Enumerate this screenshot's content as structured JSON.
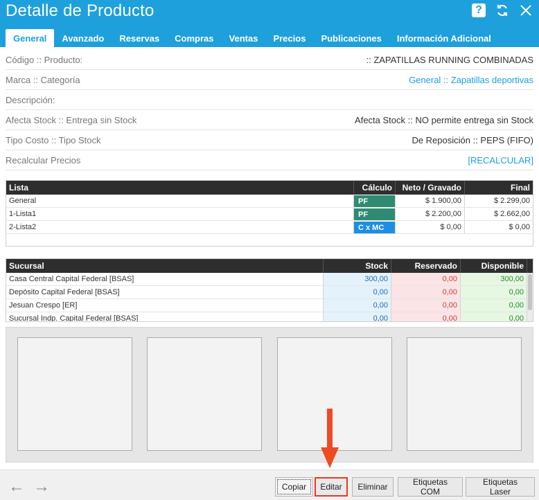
{
  "window": {
    "title": "Detalle de Producto"
  },
  "header_icons": [
    "help-icon",
    "refresh-icon",
    "close-icon"
  ],
  "tabs": [
    {
      "label": "General",
      "active": true
    },
    {
      "label": "Avanzado"
    },
    {
      "label": "Reservas"
    },
    {
      "label": "Compras"
    },
    {
      "label": "Ventas"
    },
    {
      "label": "Precios"
    },
    {
      "label": "Publicaciones"
    },
    {
      "label": "Información Adicional"
    }
  ],
  "info": {
    "codigo_label": "Código :: Producto:",
    "codigo_value": ":: ZAPATILLAS RUNNING COMBINADAS",
    "marca_label": "Marca :: Categoría",
    "marca_value_brand": "General",
    "marca_value_sep": " :: ",
    "marca_value_category": "Zapatillas deportivas",
    "descripcion_label": "Descripción:",
    "afecta_label": "Afecta Stock :: Entrega sin Stock",
    "afecta_value": "Afecta Stock :: NO permite entrega sin Stock",
    "tipo_label": "Tipo Costo :: Tipo Stock",
    "tipo_value": "De Reposición :: PEPS (FIFO)",
    "recalc_label": "Recalcular Precios",
    "recalc_link": "[RECALCULAR]"
  },
  "prices": {
    "headers": {
      "lista": "Lista",
      "calculo": "Cálculo",
      "neto": "Neto / Gravado",
      "final": "Final"
    },
    "rows": [
      {
        "lista": "General",
        "calculo": "PF",
        "neto": "$ 1.900,00",
        "final": "$ 2.299,00"
      },
      {
        "lista": "1-Lista1",
        "calculo": "PF",
        "neto": "$ 2.200,00",
        "final": "$ 2.662,00"
      },
      {
        "lista": "2-Lista2",
        "calculo": "C x MC",
        "neto": "$ 0,00",
        "final": "$ 0,00"
      }
    ],
    "colors": {
      "pf": "#2e8b72",
      "cmc": "#1e8fe0"
    }
  },
  "stock": {
    "headers": {
      "sucursal": "Sucursal",
      "stock": "Stock",
      "reservado": "Reservado",
      "disponible": "Disponible"
    },
    "rows": [
      {
        "sucursal": "Casa Central Capital Federal [BSAS]",
        "stock": "300,00",
        "reservado": "0,00",
        "disponible": "300,00"
      },
      {
        "sucursal": "Depósito Capital Federal [BSAS]",
        "stock": "0,00",
        "reservado": "0,00",
        "disponible": "0,00"
      },
      {
        "sucursal": "Jesuan Crespo [ER]",
        "stock": "0,00",
        "reservado": "0,00",
        "disponible": "0,00"
      },
      {
        "sucursal": "Sucursal Indp. Capital Federal [BSAS]",
        "stock": "0,00",
        "reservado": "0,00",
        "disponible": "0,00"
      }
    ]
  },
  "footer": {
    "copiar": "Copiar",
    "editar": "Editar",
    "eliminar": "Eliminar",
    "etiquetas_com": "Etiquetas COM",
    "etiquetas_laser": "Etiquetas Laser"
  },
  "colors": {
    "accent": "#1ea0dc",
    "highlight": "#e8391f",
    "header_dark": "#2e2e2e"
  }
}
